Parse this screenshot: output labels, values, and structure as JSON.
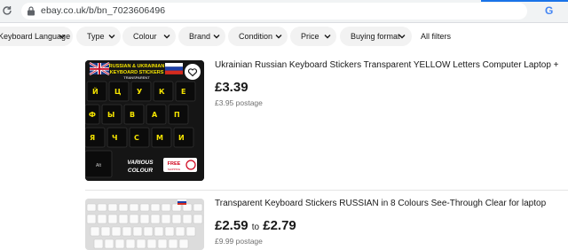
{
  "browser": {
    "url": "ebay.co.uk/b/bn_7023606496",
    "ext_label": "G"
  },
  "filters": [
    {
      "label": "Keyboard Language"
    },
    {
      "label": "Type"
    },
    {
      "label": "Colour"
    },
    {
      "label": "Brand"
    },
    {
      "label": "Condition"
    },
    {
      "label": "Price"
    },
    {
      "label": "Buying format"
    },
    {
      "label": "All filters"
    }
  ],
  "items": [
    {
      "title": "Ukrainian Russian Keyboard Stickers Transparent YELLOW Letters Computer Laptop +",
      "price": "£3.39",
      "postage": "£3.95 postage",
      "image": {
        "banner_line1": "RUSSIAN & UKRAINIAN",
        "banner_line2": "KEYBOARD STICKERS",
        "banner_line3": "TRANSPARENT",
        "promo_line1": "VARIOUS",
        "promo_line2": "COLOUR",
        "free_label": "FREE",
        "free_sub": "SHIPPING",
        "key_alt": "Alt"
      }
    },
    {
      "title": "Transparent Keyboard Stickers RUSSIAN in 8 Colours See-Through Clear for laptop",
      "price_from": "£2.59",
      "price_to_word": "to",
      "price_to": "£2.79",
      "postage": "£9.99 postage"
    }
  ],
  "colors": {
    "chip_bg": "#f2f2f2",
    "sticker_yellow": "#f5e400",
    "promo_red": "#d0021b"
  }
}
